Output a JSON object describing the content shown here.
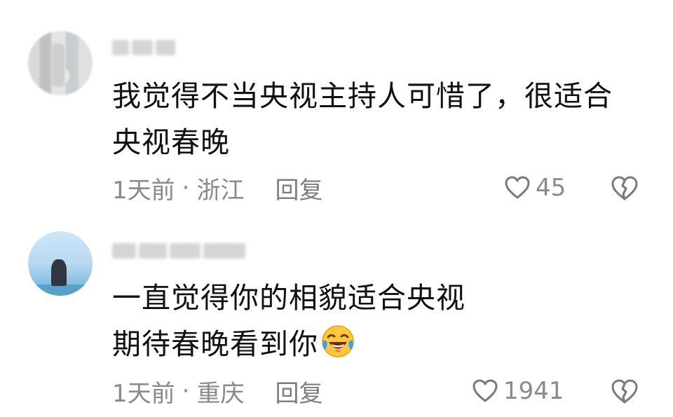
{
  "comments": [
    {
      "content_lines": [
        "我觉得不当央视主持人可惜了，很适合",
        "央视春晚"
      ],
      "time": "1天前",
      "separator": "·",
      "location": "浙江",
      "reply_label": "回复",
      "likes": "45",
      "avatar_icon": "user-avatar-photo"
    },
    {
      "content_lines": [
        "一直觉得你的相貌适合央视",
        "期待春晚看到你"
      ],
      "emoji": "laughing-tears-emoji",
      "time": "1天前",
      "separator": "·",
      "location": "重庆",
      "reply_label": "回复",
      "likes": "1941",
      "avatar_icon": "user-avatar-photo"
    }
  ],
  "icons": {
    "like": "heart-outline-icon",
    "dislike": "broken-heart-icon"
  },
  "colors": {
    "text_primary": "#111111",
    "text_secondary": "#8a8a8a",
    "icon": "#7a7a7a",
    "emoji_yellow": "#ffc83d",
    "emoji_tear": "#3aa0e8"
  }
}
